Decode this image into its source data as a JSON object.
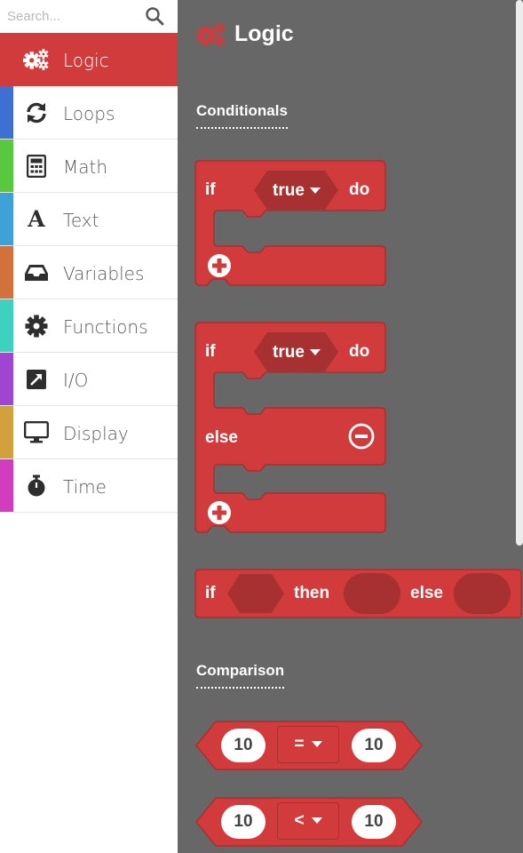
{
  "search": {
    "placeholder": "Search..."
  },
  "categories": [
    {
      "label": "Logic",
      "color": "#d23b3c",
      "icon": "gears-icon",
      "active": true
    },
    {
      "label": "Loops",
      "color": "#3e6fd2",
      "icon": "refresh-icon"
    },
    {
      "label": "Math",
      "color": "#58c93f",
      "icon": "calculator-icon"
    },
    {
      "label": "Text",
      "color": "#3fa1d6",
      "icon": "text-icon"
    },
    {
      "label": "Variables",
      "color": "#d2713c",
      "icon": "inbox-icon"
    },
    {
      "label": "Functions",
      "color": "#3dd2c0",
      "icon": "gear-icon"
    },
    {
      "label": "I/O",
      "color": "#9f45d2",
      "icon": "external-link-icon"
    },
    {
      "label": "Display",
      "color": "#d2a03c",
      "icon": "monitor-icon"
    },
    {
      "label": "Time",
      "color": "#d23cbf",
      "icon": "stopwatch-icon"
    }
  ],
  "flyout": {
    "title": "Logic",
    "sections": {
      "conditionals": "Conditionals",
      "comparison": "Comparison"
    },
    "block_if_do": {
      "if": "if",
      "cond": "true",
      "do": "do"
    },
    "block_if_else": {
      "if": "if",
      "cond": "true",
      "do": "do",
      "else": "else"
    },
    "block_ternary": {
      "if": "if",
      "then": "then",
      "else": "else"
    },
    "compare_eq": {
      "left": "10",
      "op": "=",
      "right": "10"
    },
    "compare_lt": {
      "left": "10",
      "op": "<",
      "right": "10"
    }
  },
  "colors": {
    "block": "#d23b3c",
    "block_dark": "#a73030",
    "flyout_bg": "#676767"
  }
}
